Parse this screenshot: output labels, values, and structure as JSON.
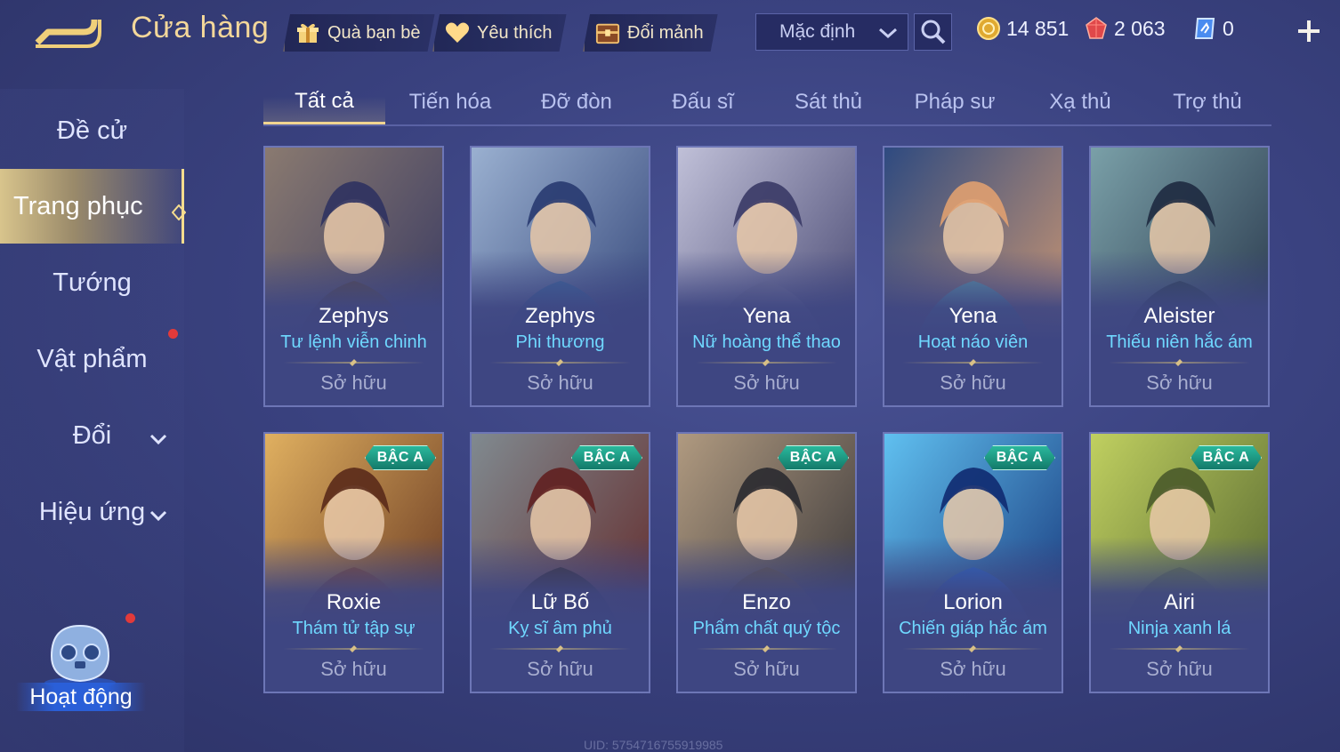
{
  "header": {
    "title": "Cửa hàng",
    "buttons": [
      {
        "label": "Quà bạn bè",
        "icon": "gift-icon"
      },
      {
        "label": "Yêu thích",
        "icon": "heart-icon"
      },
      {
        "label": "Đổi mảnh",
        "icon": "chest-icon"
      }
    ],
    "sort": {
      "selected": "Mặc định"
    },
    "currencies": [
      {
        "icon": "gold-coin-icon",
        "value": "14 851"
      },
      {
        "icon": "ruby-icon",
        "value": "2 063"
      },
      {
        "icon": "voucher-icon",
        "value": "0"
      }
    ]
  },
  "sidebar": {
    "items": [
      {
        "label": "Đề cử"
      },
      {
        "label": "Trang phục"
      },
      {
        "label": "Tướng"
      },
      {
        "label": "Vật phẩm"
      },
      {
        "label": "Đổi"
      },
      {
        "label": "Hiệu ứng"
      }
    ],
    "activity_label": "Hoạt động"
  },
  "tabs": [
    "Tất cả",
    "Tiến hóa",
    "Đỡ đòn",
    "Đấu sĩ",
    "Sát thủ",
    "Pháp sư",
    "Xạ thủ",
    "Trợ thủ"
  ],
  "cards": [
    {
      "hero": "Zephys",
      "skin": "Tư lệnh viễn chinh",
      "status": "Sở hữu",
      "tier": ""
    },
    {
      "hero": "Zephys",
      "skin": "Phi thương",
      "status": "Sở hữu",
      "tier": ""
    },
    {
      "hero": "Yena",
      "skin": "Nữ hoàng thể thao",
      "status": "Sở hữu",
      "tier": ""
    },
    {
      "hero": "Yena",
      "skin": "Hoạt náo viên",
      "status": "Sở hữu",
      "tier": ""
    },
    {
      "hero": "Aleister",
      "skin": "Thiếu niên hắc ám",
      "status": "Sở hữu",
      "tier": ""
    },
    {
      "hero": "Roxie",
      "skin": "Thám tử tập sự",
      "status": "Sở hữu",
      "tier": "BẬC A"
    },
    {
      "hero": "Lữ Bố",
      "skin": "Kỵ sĩ âm phủ",
      "status": "Sở hữu",
      "tier": "BẬC A"
    },
    {
      "hero": "Enzo",
      "skin": "Phẩm chất quý tộc",
      "status": "Sở hữu",
      "tier": "BẬC A"
    },
    {
      "hero": "Lorion",
      "skin": "Chiến giáp hắc ám",
      "status": "Sở hữu",
      "tier": "BẬC A"
    },
    {
      "hero": "Airi",
      "skin": "Ninja xanh lá",
      "status": "Sở hữu",
      "tier": "BẬC A"
    }
  ],
  "footer": {
    "uid": "UID: 5754716755919985"
  },
  "colors": {
    "accent_gold": "#f1d590",
    "skin_name": "#6fd8ff",
    "tier_badge": "#1f9e86"
  }
}
